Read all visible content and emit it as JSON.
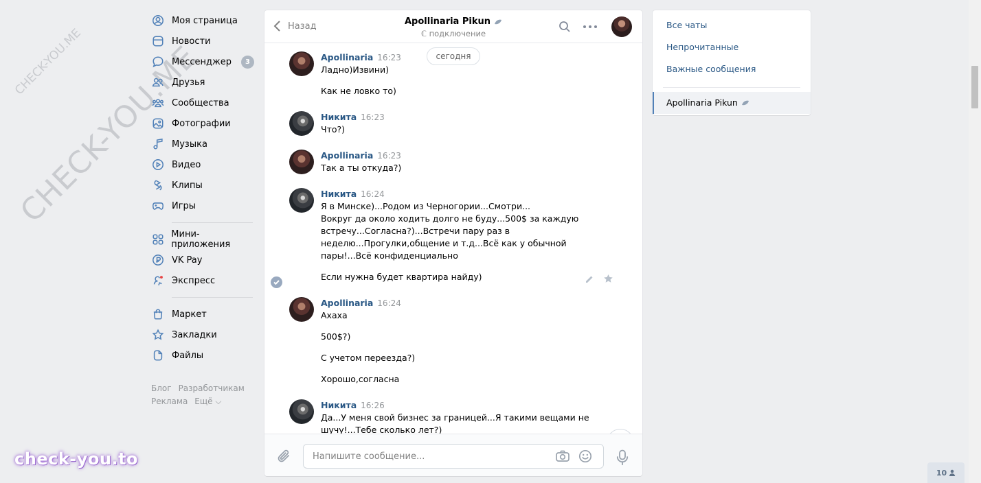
{
  "watermark": {
    "small": "CHECK-YOU.ME",
    "large": "CHECK-YOU.ME",
    "brand": "check-you.to"
  },
  "sidebar": {
    "items": [
      {
        "label": "Моя страница",
        "icon": "user-circle-icon"
      },
      {
        "label": "Новости",
        "icon": "news-icon"
      },
      {
        "label": "Мессенджер",
        "icon": "messenger-icon",
        "badge": "3"
      },
      {
        "label": "Друзья",
        "icon": "friends-icon"
      },
      {
        "label": "Сообщества",
        "icon": "communities-icon"
      },
      {
        "label": "Фотографии",
        "icon": "photos-icon"
      },
      {
        "label": "Музыка",
        "icon": "music-icon"
      },
      {
        "label": "Видео",
        "icon": "video-icon"
      },
      {
        "label": "Клипы",
        "icon": "clips-icon"
      },
      {
        "label": "Игры",
        "icon": "games-icon"
      },
      {
        "label": "Мини-приложения",
        "icon": "mini-apps-icon"
      },
      {
        "label": "VK Pay",
        "icon": "vkpay-icon"
      },
      {
        "label": "Экспресс",
        "icon": "express-icon"
      },
      {
        "label": "Маркет",
        "icon": "market-icon"
      },
      {
        "label": "Закладки",
        "icon": "bookmarks-icon"
      },
      {
        "label": "Файлы",
        "icon": "files-icon"
      }
    ],
    "footer": {
      "blog": "Блог",
      "developers": "Разработчикам",
      "ads": "Реклама",
      "more": "Ещё ⌵"
    }
  },
  "chat": {
    "back_label": "Назад",
    "peer_name": "Apollinaria Pikun",
    "peer_status": "ℂ подключение",
    "day_label": "сегодня",
    "messages": [
      {
        "author": "Apollinaria",
        "time": "16:23",
        "lines": [
          "Ладно)Извини)",
          "Как не ловко то)"
        ]
      },
      {
        "author": "Никита",
        "time": "16:23",
        "lines": [
          "Что?)"
        ]
      },
      {
        "author": "Apollinaria",
        "time": "16:23",
        "lines": [
          "Так а ты откуда?)"
        ]
      },
      {
        "author": "Никита",
        "time": "16:24",
        "lines": [
          "Я в Минске)...Родом из Черногории...Смотри...\nВокруг да около ходить долго не буду...500$ за каждую\nвстречу...Согласна?)...Встречи пару раз в\nнеделю...Прогулки,общение и т.д...Всё как у обычной\nпары!...Всё конфиденциально",
          "Если нужна будет квартира найду)"
        ]
      },
      {
        "author": "Apollinaria",
        "time": "16:24",
        "lines": [
          "Ахаха",
          "500$?)",
          "С учетом переезда?)",
          "Хорошо,согласна"
        ]
      },
      {
        "author": "Никита",
        "time": "16:26",
        "lines": [
          "Да...У меня свой бизнес за границей...Я такими вещами не\nшучу!...Тебе сколько лет?)"
        ]
      }
    ],
    "composer_placeholder": "Напишите сообщение..."
  },
  "right_panel": {
    "filters": [
      "Все чаты",
      "Непрочитанные",
      "Важные сообщения"
    ],
    "active_chat": "Apollinaria Pikun"
  },
  "online_counter": "10",
  "colors": {
    "accent": "#5181b8",
    "link": "#2a5885",
    "background": "#edeef0"
  }
}
